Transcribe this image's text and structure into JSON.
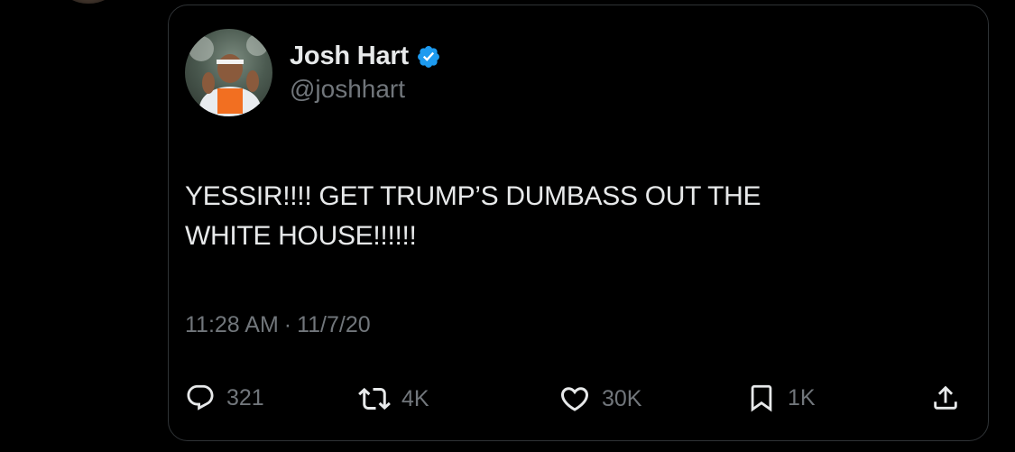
{
  "tweet": {
    "author": {
      "display_name": "Josh Hart",
      "handle": "@joshhart",
      "verified": true,
      "verified_color": "#1d9bf0"
    },
    "text_lines": [
      "YESSIR!!!! GET TRUMP’S DUMBASS OUT THE",
      "WHITE HOUSE!!!!!!"
    ],
    "time": "11:28 AM",
    "separator": "·",
    "date": "11/7/20",
    "stats": {
      "replies": "321",
      "reposts": "4K",
      "likes": "30K",
      "bookmarks": "1K"
    },
    "icons": {
      "reply": "speech-bubble-icon",
      "repost": "repost-arrows-icon",
      "like": "heart-icon",
      "bookmark": "bookmark-icon",
      "share": "share-upload-icon"
    }
  },
  "colors": {
    "background": "#000000",
    "text": "#e7e9ea",
    "muted": "#71767b",
    "border": "#2f3336"
  }
}
